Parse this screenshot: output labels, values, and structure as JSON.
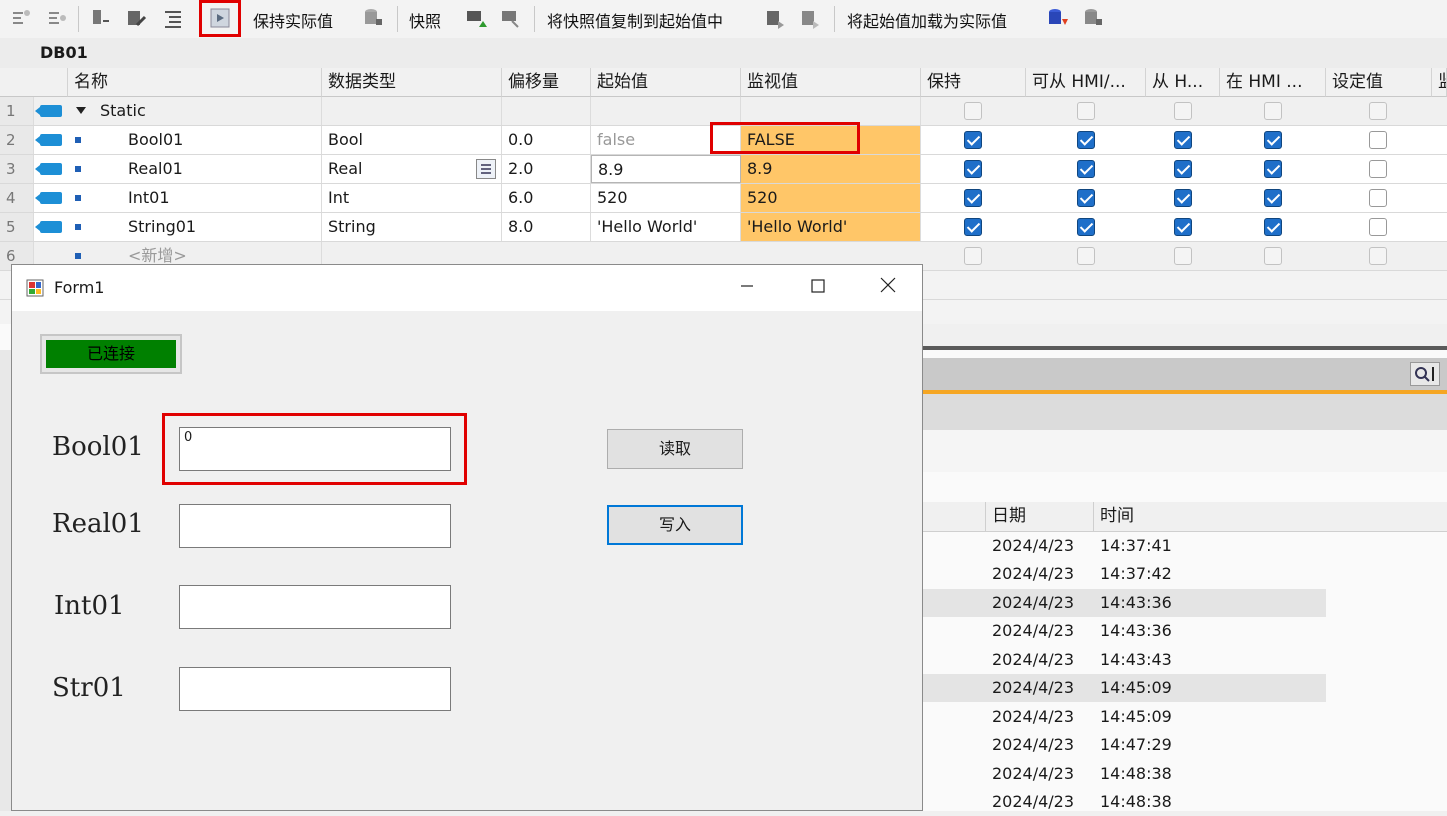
{
  "toolbar": {
    "keep_actual": "保持实际值",
    "snapshot": "快照",
    "copy_snapshot": "将快照值复制到起始值中",
    "load_start": "将起始值加载为实际值"
  },
  "db": {
    "title": "DB01"
  },
  "columns": {
    "name": "名称",
    "type": "数据类型",
    "offset": "偏移量",
    "start": "起始值",
    "monitor": "监视值",
    "retain": "保持",
    "hmi_access": "可从 HMI/...",
    "hmi_from": "从 H...",
    "hmi_in": "在 HMI ...",
    "setpoint": "设定值",
    "more": "监"
  },
  "rows": [
    {
      "num": "1",
      "name": "Static",
      "type": "",
      "offset": "",
      "start": "",
      "monitor": ""
    },
    {
      "num": "2",
      "name": "Bool01",
      "type": "Bool",
      "offset": "0.0",
      "start": "false",
      "monitor": "FALSE"
    },
    {
      "num": "3",
      "name": "Real01",
      "type": "Real",
      "offset": "2.0",
      "start": "8.9",
      "monitor": "8.9"
    },
    {
      "num": "4",
      "name": "Int01",
      "type": "Int",
      "offset": "6.0",
      "start": "520",
      "monitor": "520"
    },
    {
      "num": "5",
      "name": "String01",
      "type": "String",
      "offset": "8.0",
      "start": "'Hello World'",
      "monitor": "'Hello World'"
    },
    {
      "num": "6",
      "name": "<新增>",
      "type": "",
      "offset": "",
      "start": "",
      "monitor": ""
    }
  ],
  "log": {
    "date_header": "日期",
    "time_header": "时间",
    "entries": [
      {
        "date": "2024/4/23",
        "time": "14:37:41"
      },
      {
        "date": "2024/4/23",
        "time": "14:37:42"
      },
      {
        "date": "2024/4/23",
        "time": "14:43:36"
      },
      {
        "date": "2024/4/23",
        "time": "14:43:36"
      },
      {
        "date": "2024/4/23",
        "time": "14:43:43"
      },
      {
        "date": "2024/4/23",
        "time": "14:45:09"
      },
      {
        "date": "2024/4/23",
        "time": "14:45:09"
      },
      {
        "date": "2024/4/23",
        "time": "14:47:29"
      },
      {
        "date": "2024/4/23",
        "time": "14:48:38"
      },
      {
        "date": "2024/4/23",
        "time": "14:48:38"
      }
    ]
  },
  "form1": {
    "title": "Form1",
    "status": "已连接",
    "status_color": "#008000",
    "labels": {
      "bool": "Bool01",
      "real": "Real01",
      "int": "Int01",
      "str": "Str01"
    },
    "values": {
      "bool": "0",
      "real": "",
      "int": "",
      "str": ""
    },
    "read_button": "读取",
    "write_button": "写入"
  }
}
